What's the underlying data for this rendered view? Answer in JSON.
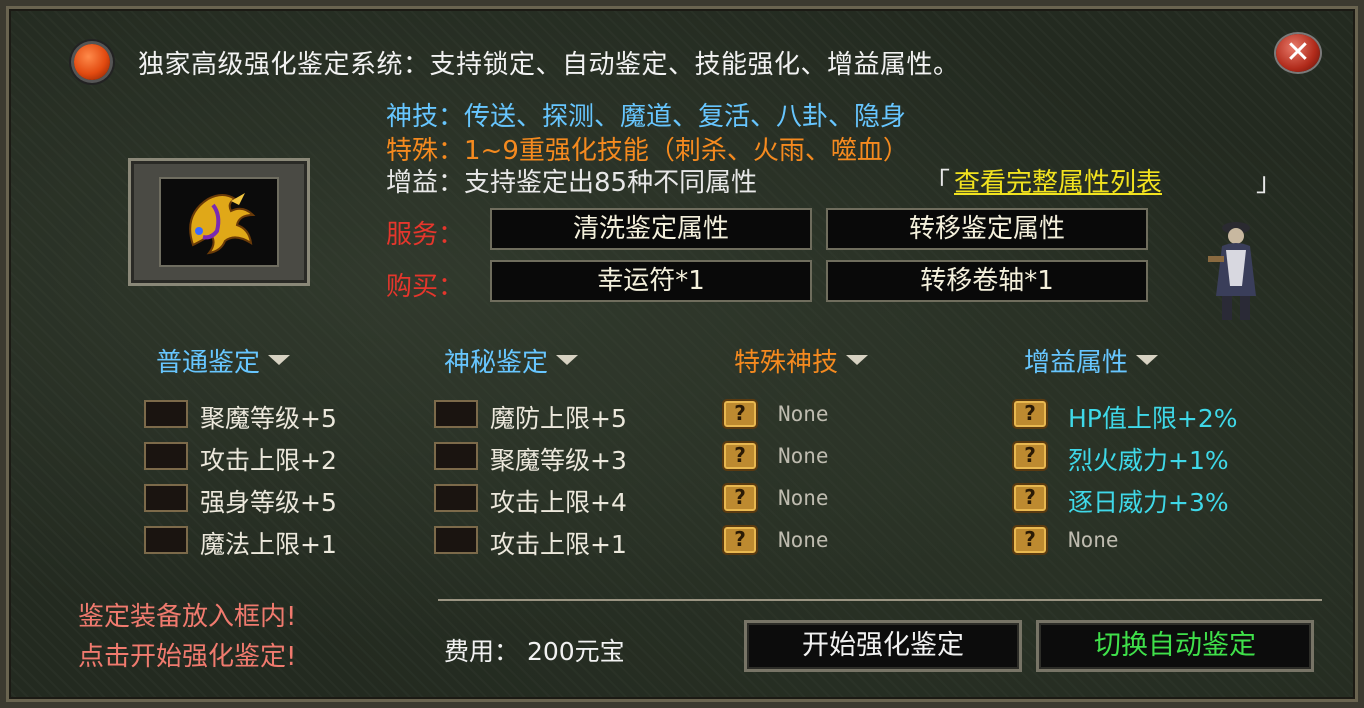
{
  "header": {
    "title": "独家高级强化鉴定系统：支持锁定、自动鉴定、技能强化、增益属性。",
    "close_icon": "close-icon"
  },
  "info": {
    "skills_label": "神技：",
    "skills_value": "传送、探测、魔道、复活、八卦、隐身",
    "special_label": "特殊：",
    "special_value": "1~9重强化技能（刺杀、火雨、噬血）",
    "buff_label": "增益：",
    "buff_value": "支持鉴定出85种不同属性",
    "bracket_open": "「",
    "link_label": "查看完整属性列表",
    "bracket_close": "」"
  },
  "service": {
    "label": "服务：",
    "buttons": [
      "清洗鉴定属性",
      "转移鉴定属性"
    ]
  },
  "purchase": {
    "label": "购买：",
    "buttons": [
      "幸运符*1",
      "转移卷轴*1"
    ]
  },
  "columns": [
    {
      "header": "普通鉴定",
      "header_color": "#67c6ff",
      "rows": [
        "聚魔等级+5",
        "攻击上限+2",
        "强身等级+5",
        "魔法上限+1"
      ]
    },
    {
      "header": "神秘鉴定",
      "header_color": "#67c6ff",
      "rows": [
        "魔防上限+5",
        "聚魔等级+3",
        "攻击上限+4",
        "攻击上限+1"
      ]
    },
    {
      "header": "特殊神技",
      "header_color": "#f58a1f",
      "rows": [
        "None",
        "None",
        "None",
        "None"
      ]
    },
    {
      "header": "增益属性",
      "header_color": "#67c6ff",
      "rows": [
        "HP值上限+2%",
        "烈火威力+1%",
        "逐日威力+3%",
        "None"
      ]
    }
  ],
  "hints": [
    "鉴定装备放入框内!",
    "点击开始强化鉴定!"
  ],
  "cost": "费用： 200元宝",
  "actions": {
    "start": "开始强化鉴定",
    "auto": "切换自动鉴定",
    "start_color": "#f2f2f2",
    "auto_color": "#3fe04a"
  },
  "colors": {
    "service_label": "#e5362c",
    "hint": "#f07a6e",
    "link": "#f2e31f"
  }
}
